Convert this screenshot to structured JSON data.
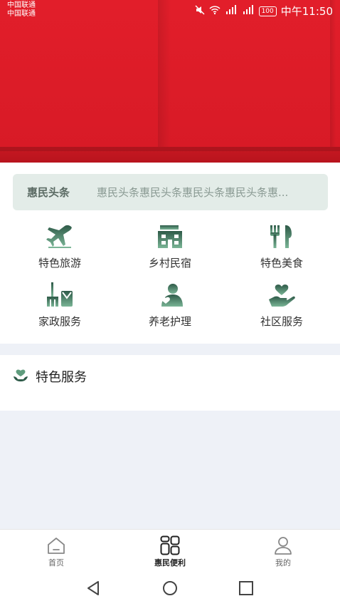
{
  "status_bar": {
    "carrier_1": "中国联通",
    "carrier_2": "中国联通",
    "battery": "100",
    "time": "中午11:50"
  },
  "ticker": {
    "title": "惠民头条",
    "text": "惠民头条惠民头条惠民头条惠民头条惠..."
  },
  "services": [
    {
      "label": "特色旅游",
      "icon": "airplane-icon"
    },
    {
      "label": "乡村民宿",
      "icon": "house-icon"
    },
    {
      "label": "特色美食",
      "icon": "cutlery-icon"
    },
    {
      "label": "家政服务",
      "icon": "broom-icon"
    },
    {
      "label": "养老护理",
      "icon": "elder-care-icon"
    },
    {
      "label": "社区服务",
      "icon": "hand-heart-icon"
    }
  ],
  "special": {
    "title": "特色服务",
    "icon": "hand-leaf-icon"
  },
  "tabbar": {
    "items": [
      {
        "label": "首页",
        "icon": "home-icon"
      },
      {
        "label": "惠民便利",
        "icon": "grid-icon"
      },
      {
        "label": "我的",
        "icon": "user-icon"
      }
    ]
  },
  "colors": {
    "banner_red": "#e21e2a",
    "icon_green_dark": "#3f6b58",
    "icon_green_light": "#6aa486",
    "ticker_bg": "#e3ece8",
    "page_bg": "#eef1f7"
  }
}
